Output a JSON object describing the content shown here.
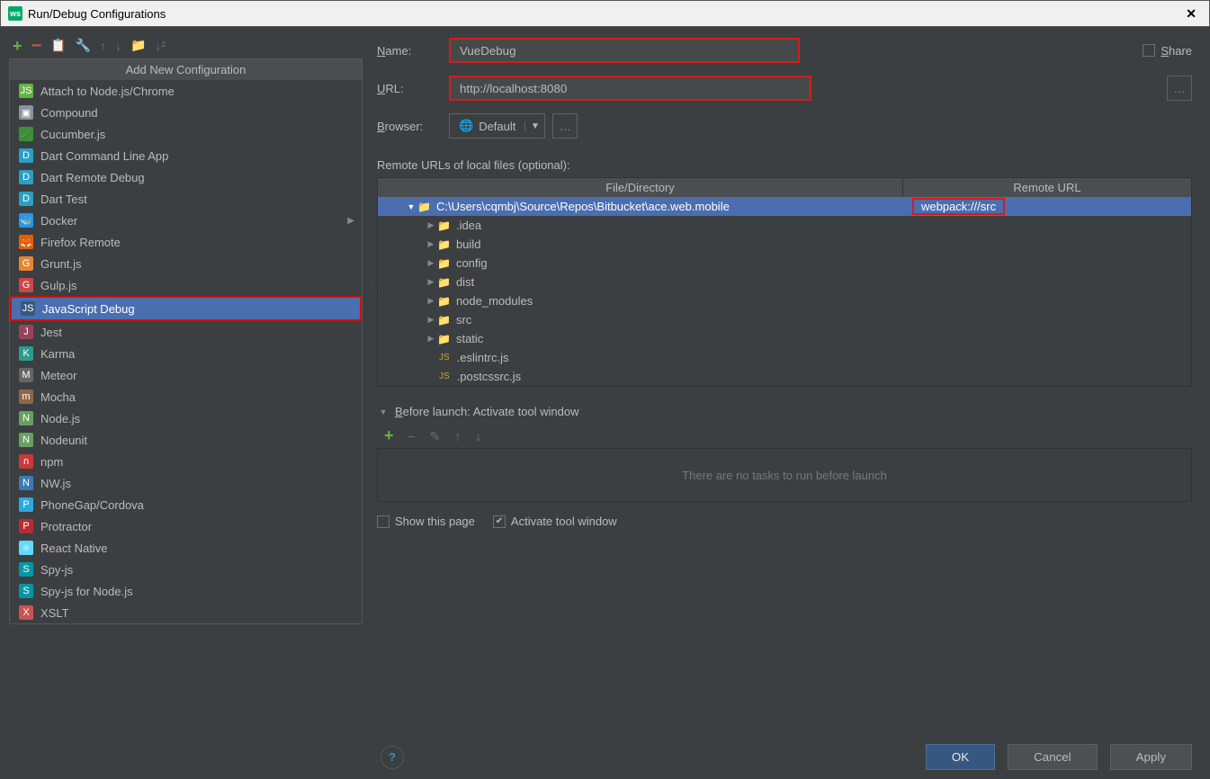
{
  "window": {
    "title": "Run/Debug Configurations"
  },
  "sidebar": {
    "header": "Add New Configuration",
    "items": [
      {
        "label": "Attach to Node.js/Chrome",
        "iconBg": "#62b543",
        "iconTxt": "JS"
      },
      {
        "label": "Compound",
        "iconBg": "#87939a",
        "iconTxt": "▣"
      },
      {
        "label": "Cucumber.js",
        "iconBg": "#3a8f3a",
        "iconTxt": "🥒"
      },
      {
        "label": "Dart Command Line App",
        "iconBg": "#2aa0c4",
        "iconTxt": "D"
      },
      {
        "label": "Dart Remote Debug",
        "iconBg": "#2aa0c4",
        "iconTxt": "D"
      },
      {
        "label": "Dart Test",
        "iconBg": "#2aa0c4",
        "iconTxt": "D"
      },
      {
        "label": "Docker",
        "iconBg": "#2496ed",
        "iconTxt": "🐳",
        "submenu": true
      },
      {
        "label": "Firefox Remote",
        "iconBg": "#e66000",
        "iconTxt": "🦊"
      },
      {
        "label": "Grunt.js",
        "iconBg": "#e48632",
        "iconTxt": "G"
      },
      {
        "label": "Gulp.js",
        "iconBg": "#cf4647",
        "iconTxt": "G"
      },
      {
        "label": "JavaScript Debug",
        "iconBg": "#365880",
        "iconTxt": "JS",
        "selected": true
      },
      {
        "label": "Jest",
        "iconBg": "#99425b",
        "iconTxt": "J"
      },
      {
        "label": "Karma",
        "iconBg": "#2a9c8f",
        "iconTxt": "K"
      },
      {
        "label": "Meteor",
        "iconBg": "#666",
        "iconTxt": "M"
      },
      {
        "label": "Mocha",
        "iconBg": "#8d6748",
        "iconTxt": "m"
      },
      {
        "label": "Node.js",
        "iconBg": "#68a063",
        "iconTxt": "N"
      },
      {
        "label": "Nodeunit",
        "iconBg": "#68a063",
        "iconTxt": "N"
      },
      {
        "label": "npm",
        "iconBg": "#cb3837",
        "iconTxt": "n"
      },
      {
        "label": "NW.js",
        "iconBg": "#3c7ab5",
        "iconTxt": "N"
      },
      {
        "label": "PhoneGap/Cordova",
        "iconBg": "#28a9e0",
        "iconTxt": "P"
      },
      {
        "label": "Protractor",
        "iconBg": "#b52e31",
        "iconTxt": "P"
      },
      {
        "label": "React Native",
        "iconBg": "#61dafb",
        "iconTxt": "⚛"
      },
      {
        "label": "Spy-js",
        "iconBg": "#0097a7",
        "iconTxt": "S"
      },
      {
        "label": "Spy-js for Node.js",
        "iconBg": "#0097a7",
        "iconTxt": "S"
      },
      {
        "label": "XSLT",
        "iconBg": "#c75450",
        "iconTxt": "X"
      }
    ]
  },
  "form": {
    "name_label": "Name:",
    "name_value": "VueDebug",
    "share_label": "Share",
    "url_label": "URL:",
    "url_value": "http://localhost:8080",
    "browser_label": "Browser:",
    "browser_value": "Default",
    "remote_label": "Remote URLs of local files (optional):",
    "tree_col1": "File/Directory",
    "tree_col2": "Remote URL",
    "root_path": "C:\\Users\\cqmbj\\Source\\Repos\\Bitbucket\\ace.web.mobile",
    "root_remote": "webpack:///src",
    "folders": [
      ".idea",
      "build",
      "config",
      "dist",
      "node_modules",
      "src",
      "static"
    ],
    "files": [
      ".eslintrc.js",
      ".postcssrc.js"
    ]
  },
  "before": {
    "header": "Before launch: Activate tool window",
    "empty": "There are no tasks to run before launch",
    "show_page": "Show this page",
    "activate": "Activate tool window"
  },
  "buttons": {
    "ok": "OK",
    "cancel": "Cancel",
    "apply": "Apply"
  }
}
